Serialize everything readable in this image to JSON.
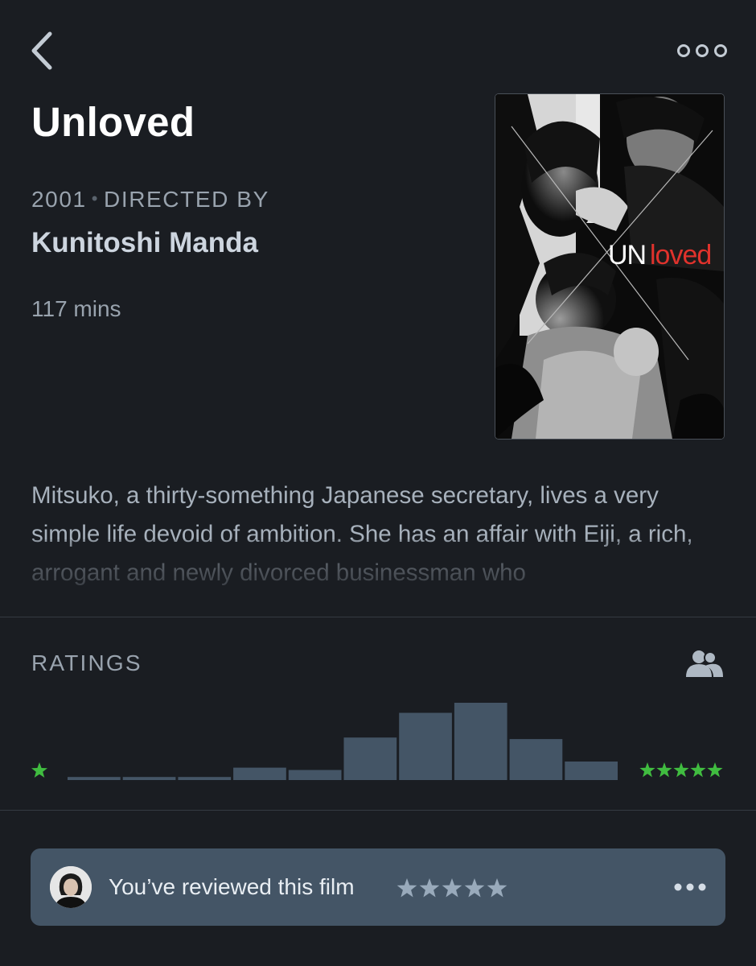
{
  "film": {
    "title": "Unloved",
    "year": "2001",
    "directed_by_label": "DIRECTED BY",
    "director": "Kunitoshi Manda",
    "runtime": "117 mins",
    "synopsis": "Mitsuko, a thirty-something Japanese secretary, lives a very simple life devoid of ambition. She has an affair with Eiji, a rich, arrogant and newly divorced businessman who"
  },
  "poster": {
    "title_part1": "UN",
    "title_part2": "loved",
    "accent_color": "#e0322c"
  },
  "ratings": {
    "label": "RATINGS",
    "distribution": [
      0.04,
      0.04,
      0.04,
      0.16,
      0.13,
      0.55,
      0.87,
      1.0,
      0.53,
      0.24
    ],
    "min_star": "★",
    "max_stars": "★★★★★",
    "star_color": "#40bc40"
  },
  "review": {
    "text": "You’ve reviewed this film",
    "stars": "★★★★★",
    "rating": 5
  },
  "icons": {
    "back": "chevron-left-icon",
    "more": "more-circles-icon",
    "friends": "people-icon",
    "review_more": "more-dots-icon"
  },
  "colors": {
    "background": "#1a1d22",
    "bar": "#445566",
    "card": "#445566",
    "green_star": "#40bc40",
    "review_star": "#99aabb"
  }
}
